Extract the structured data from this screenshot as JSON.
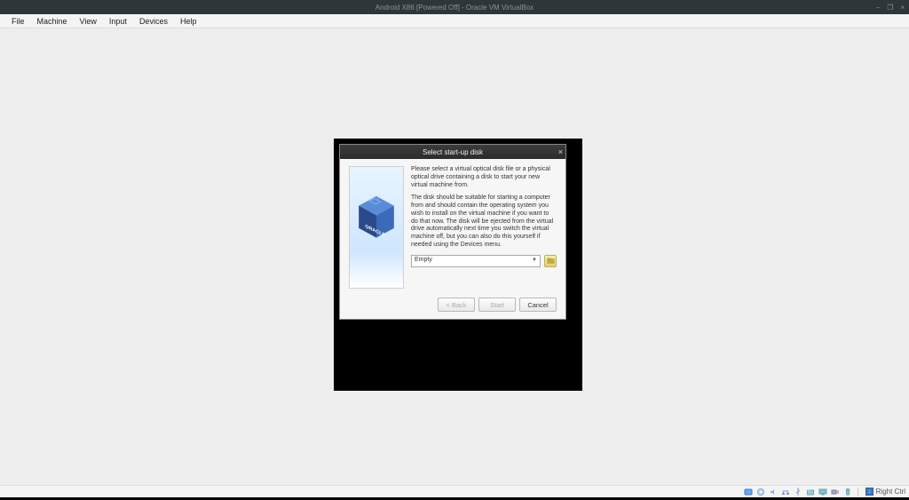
{
  "window": {
    "title": "Android X86 [Powered Off] - Oracle VM VirtualBox",
    "controls": {
      "minimize": "–",
      "maximize": "❐",
      "close": "×"
    }
  },
  "menubar": [
    "File",
    "Machine",
    "View",
    "Input",
    "Devices",
    "Help"
  ],
  "dialog": {
    "title": "Select start-up disk",
    "close": "×",
    "para1": "Please select a virtual optical disk file or a physical optical drive containing a disk to start your new virtual machine from.",
    "para2": "The disk should be suitable for starting a computer from and should contain the operating system you wish to install on the virtual machine if you want to do that now. The disk will be ejected from the virtual drive automatically next time you switch the virtual machine off, but you can also do this yourself if needed using the Devices menu.",
    "disk_selected": "Empty",
    "buttons": {
      "back": "< Back",
      "start": "Start",
      "cancel": "Cancel"
    }
  },
  "statusbar": {
    "host_key": "Right Ctrl"
  }
}
